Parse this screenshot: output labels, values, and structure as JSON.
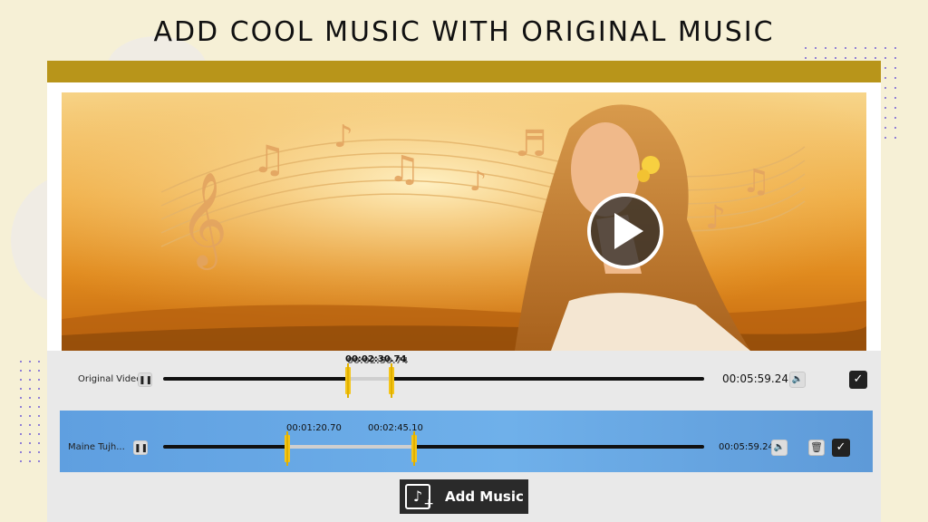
{
  "headline": "ADD COOL MUSIC WITH ORIGINAL MUSIC",
  "colors": {
    "accent_bar": "#b8951a",
    "music_row": "#6fb0ea",
    "handle": "#f5c518"
  },
  "video": {
    "play_icon": "play-icon"
  },
  "original_track": {
    "label": "Original Video",
    "pause_icon": "pause-icon",
    "overlap_time_a": "00:02:30.74",
    "overlap_time_b": "00:02:50.74",
    "duration": "00:05:59.24",
    "volume_icon": "volume-icon",
    "confirm_icon": "check-icon"
  },
  "music_track": {
    "label": "Maine Tujh...",
    "pause_icon": "pause-icon",
    "start_time": "00:01:20.70",
    "end_time": "00:02:45.10",
    "duration": "00:05:59.24",
    "volume_icon": "volume-icon",
    "delete_icon": "trash-icon",
    "confirm_icon": "check-icon"
  },
  "add_music": {
    "label": "Add Music",
    "icon": "music-note-plus-icon"
  }
}
